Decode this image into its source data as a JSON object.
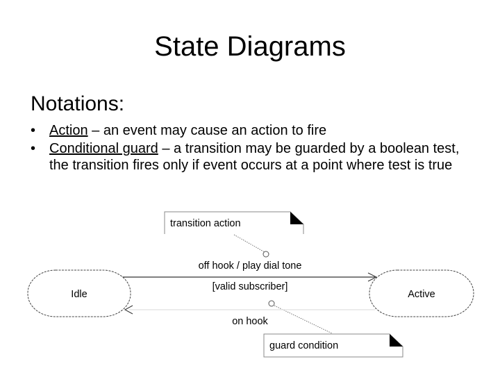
{
  "slide": {
    "title": "State Diagrams",
    "subtitle": "Notations:",
    "bullets": [
      {
        "bullet": "•",
        "term": "Action",
        "separator": " – ",
        "text": "an event may cause an action to fire"
      },
      {
        "bullet": "•",
        "term": "Conditional guard",
        "separator": " – ",
        "text": "a transition may be guarded by a boolean test, the transition fires only if event occurs at a point where test is true"
      }
    ]
  },
  "diagram": {
    "states": [
      {
        "id": "idle",
        "label": "Idle"
      },
      {
        "id": "active",
        "label": "Active"
      }
    ],
    "transitions": [
      {
        "from": "idle",
        "to": "active",
        "event_label": "off hook / play dial tone",
        "guard_label": "[valid subscriber]"
      },
      {
        "from": "active",
        "to": "idle",
        "event_label": "on hook"
      }
    ],
    "notes": [
      {
        "id": "transition-action-note",
        "label": "transition action"
      },
      {
        "id": "guard-condition-note",
        "label": "guard condition"
      }
    ],
    "colors": {
      "line": "#333333",
      "faint_line": "#e6e6e6",
      "state_border": "#444444",
      "note_border": "#888888",
      "corner_fill": "#000000"
    }
  }
}
